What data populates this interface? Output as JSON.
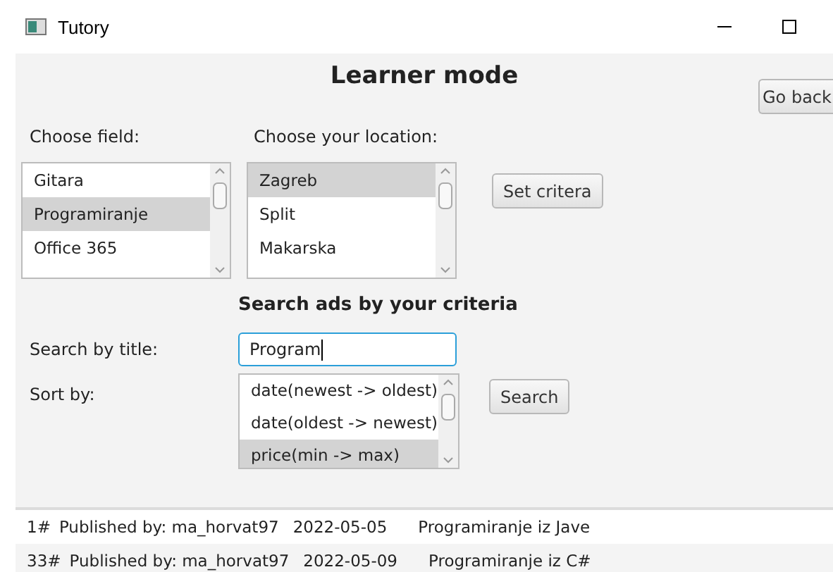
{
  "window": {
    "title": "Tutory"
  },
  "heading": "Learner mode",
  "go_back_button": "Go back",
  "field_label": "Choose field:",
  "field_list": [
    {
      "label": "Gitara",
      "selected": false
    },
    {
      "label": "Programiranje",
      "selected": true
    },
    {
      "label": "Office 365",
      "selected": false
    }
  ],
  "location_label": "Choose your location:",
  "location_list": [
    {
      "label": "Zagreb",
      "selected": true
    },
    {
      "label": "Split",
      "selected": false
    },
    {
      "label": "Makarska",
      "selected": false
    }
  ],
  "set_criteria_button": "Set critera",
  "search_heading": "Search ads by your criteria",
  "search_label": "Search by title:",
  "search_value": "Program",
  "sort_label": "Sort by:",
  "sort_list": [
    {
      "label": "date(newest -> oldest)",
      "selected": false
    },
    {
      "label": "date(oldest -> newest)",
      "selected": false
    },
    {
      "label": "price(min -> max)",
      "selected": true
    }
  ],
  "search_button": "Search",
  "results": [
    {
      "number": "1#",
      "publisher": "Published by: ma_horvat97",
      "date": "2022-05-05",
      "title": "Programiranje iz Jave"
    },
    {
      "number": "33#",
      "publisher": "Published by: ma_horvat97",
      "date": "2022-05-09",
      "title": "Programiranje iz C#"
    }
  ]
}
